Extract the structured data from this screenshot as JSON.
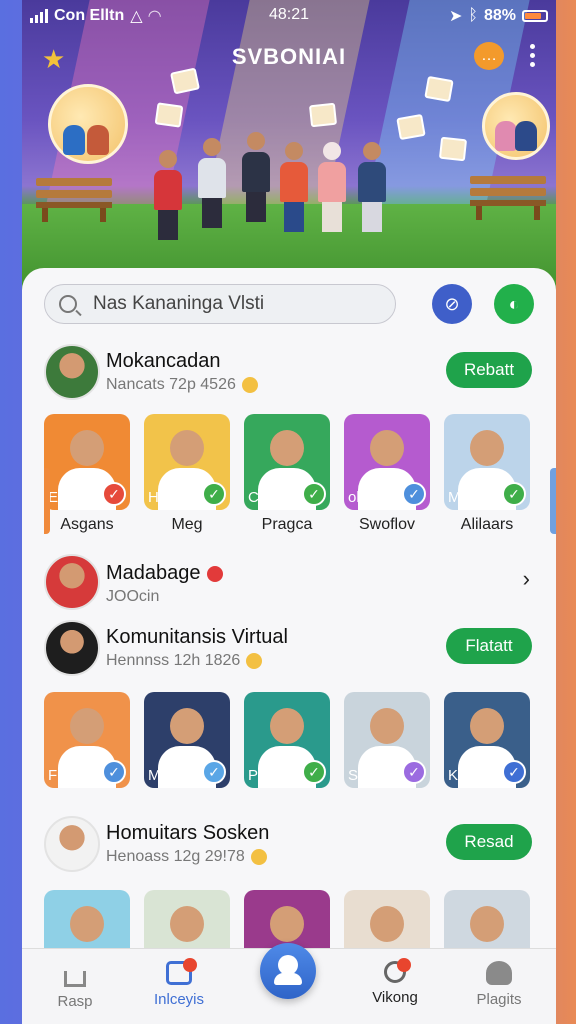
{
  "status_bar": {
    "carrier": "Con Elltn",
    "time": "48:21",
    "battery": "88%",
    "battery_color": "#ff8a3d"
  },
  "hero": {
    "title": "SVBONIAI"
  },
  "search": {
    "value": "Nas Kananinga Vlsti"
  },
  "sections": [
    {
      "title": "Mokancadan",
      "subtitle": "Nancats 72p 4526",
      "action": "Rebatt",
      "tiles": [
        {
          "tag": "Exacn",
          "name": "Asgans",
          "bg": "#f08a34",
          "check": "#e64a3b"
        },
        {
          "tag": "Hean",
          "name": "Meg",
          "bg": "#f2c34a",
          "check": "#3fae49"
        },
        {
          "tag": "Cacpn",
          "name": "Pragca",
          "bg": "#36a85c",
          "check": "#3fae49"
        },
        {
          "tag": "olgoin",
          "name": "Swoflov",
          "bg": "#b55bcf",
          "check": "#4e8fdc"
        },
        {
          "tag": "Mlaa",
          "name": "Alilaars",
          "bg": "#bcd4ea",
          "check": "#3fae49"
        }
      ]
    },
    {
      "title": "Madabage",
      "subtitle": "JOOcin"
    },
    {
      "title": "Komunitansis Virtual",
      "subtitle": "Hennnss 12h 1826",
      "action": "Flatatt",
      "tiles": [
        {
          "tag": "Flatia",
          "name": "",
          "bg": "#f0924a",
          "check": "#4e8fdc"
        },
        {
          "tag": "Medan",
          "name": "",
          "bg": "#2d3f6a",
          "check": "#5aa6e6"
        },
        {
          "tag": "Peciar",
          "name": "",
          "bg": "#2a9a8c",
          "check": "#3fae49"
        },
        {
          "tag": "Sttao",
          "name": "",
          "bg": "#c9d4dc",
          "check": "#9b6be0"
        },
        {
          "tag": "Klolatt",
          "name": "",
          "bg": "#3a5f8a",
          "check": "#3f6fd4"
        }
      ]
    },
    {
      "title": "Homuitars Sosken",
      "subtitle": "Henoass 12g 29!78",
      "action": "Resad"
    }
  ],
  "bottom_row": [
    {
      "bg": "#8fd0e6"
    },
    {
      "bg": "#d9e4d4"
    },
    {
      "bg": "#9a3a8c"
    },
    {
      "bg": "#e8ddd0"
    },
    {
      "bg": "#cfd8e0"
    }
  ],
  "nav": {
    "home": "Rasp",
    "inbox": "Inlceyis",
    "search": "Vikong",
    "profile": "Plagits"
  }
}
